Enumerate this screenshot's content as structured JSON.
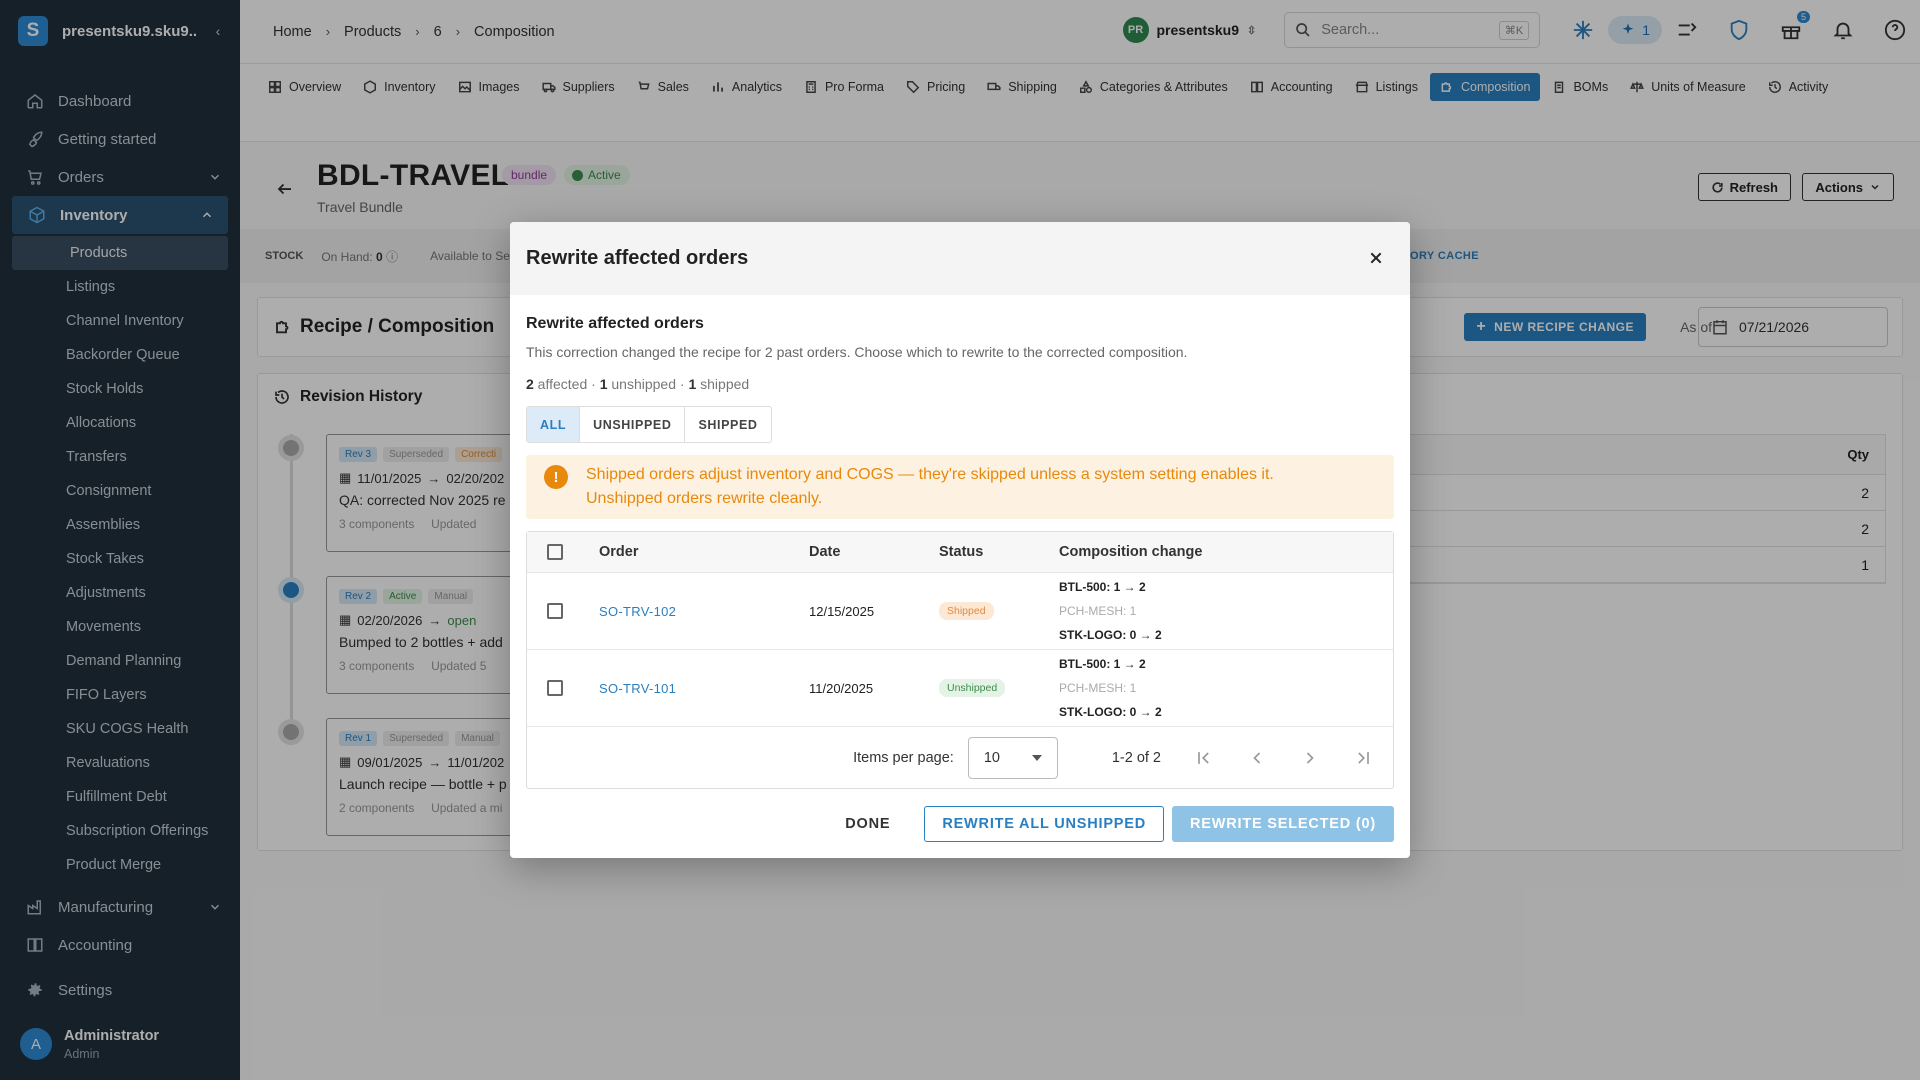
{
  "sidebar": {
    "org": "presentsku9.sku9....",
    "nav": [
      {
        "label": "Dashboard",
        "icon": "home-icon"
      },
      {
        "label": "Getting started",
        "icon": "rocket-icon"
      },
      {
        "label": "Orders",
        "icon": "cart-icon"
      },
      {
        "label": "Inventory",
        "icon": "box-icon"
      }
    ],
    "inventory_sub": [
      "Products",
      "Listings",
      "Channel Inventory",
      "Backorder Queue",
      "Stock Holds",
      "Allocations",
      "Transfers",
      "Consignment",
      "Assemblies",
      "Stock Takes",
      "Adjustments",
      "Movements",
      "Demand Planning",
      "FIFO Layers",
      "SKU COGS Health",
      "Revaluations",
      "Fulfillment Debt",
      "Subscription Offerings",
      "Product Merge"
    ],
    "manufacturing": "Manufacturing",
    "accounting": "Accounting",
    "settings": "Settings",
    "user": {
      "initial": "A",
      "name": "Administrator",
      "role": "Admin"
    }
  },
  "topbar": {
    "crumbs": [
      "Home",
      "Products",
      "6",
      "Composition"
    ],
    "user_initials": "PR",
    "user_name": "presentsku9",
    "search_placeholder": "Search...",
    "search_shortcut": "⌘K",
    "ai_count": "1",
    "gift_badge": "5"
  },
  "tabs": [
    "Overview",
    "Inventory",
    "Images",
    "Suppliers",
    "Sales",
    "Analytics",
    "Pro Forma",
    "Pricing",
    "Shipping",
    "Categories & Attributes",
    "Accounting",
    "Listings",
    "Composition",
    "BOMs",
    "Units of Measure",
    "Activity"
  ],
  "active_tab": "Composition",
  "product": {
    "sku": "BDL-TRAVEL",
    "type_badge": "bundle",
    "status": "Active",
    "name": "Travel Bundle",
    "refresh": "Refresh",
    "actions": "Actions"
  },
  "stock": {
    "label": "STOCK",
    "on_hand_label": "On Hand:",
    "on_hand": "0",
    "available": "Available to Se",
    "cache_link": "ORY CACHE"
  },
  "recipe": {
    "title": "Recipe / Composition",
    "new_change": "NEW RECIPE CHANGE",
    "as_of": "As of",
    "date": "07/21/2026",
    "qty_header": "Qty",
    "qtys": [
      "2",
      "2",
      "1"
    ]
  },
  "history": {
    "title": "Revision History",
    "revisions": [
      {
        "rev": "Rev 3",
        "state": "Superseded",
        "kind": "Correcti",
        "from": "11/01/2025",
        "to": "02/20/202",
        "desc": "QA: corrected Nov 2025 re",
        "components": "3 components",
        "updated": "Updated"
      },
      {
        "rev": "Rev 2",
        "state": "Active",
        "kind": "Manual",
        "from": "02/20/2026",
        "to": "open",
        "desc": "Bumped to 2 bottles + add",
        "components": "3 components",
        "updated": "Updated 5"
      },
      {
        "rev": "Rev 1",
        "state": "Superseded",
        "kind": "Manual",
        "from": "09/01/2025",
        "to": "11/01/202",
        "desc": "Launch recipe — bottle + p",
        "components": "2 components",
        "updated": "Updated a mi"
      }
    ]
  },
  "modal": {
    "title": "Rewrite affected orders",
    "subtitle": "Rewrite affected orders",
    "description": "This correction changed the recipe for 2 past orders. Choose which to rewrite to the corrected composition.",
    "counts": {
      "affected": "2",
      "affected_label": " affected · ",
      "unshipped": "1",
      "unshipped_label": " unshipped · ",
      "shipped": "1",
      "shipped_label": " shipped"
    },
    "filters": [
      "ALL",
      "UNSHIPPED",
      "SHIPPED"
    ],
    "warning": "Shipped orders adjust inventory and COGS — they're skipped unless a system setting enables it. Unshipped orders rewrite cleanly.",
    "columns": [
      "Order",
      "Date",
      "Status",
      "Composition change"
    ],
    "rows": [
      {
        "order": "SO-TRV-102",
        "date": "12/15/2025",
        "status": "Shipped",
        "changes": [
          "BTL-500: 1 → 2",
          "PCH-MESH: 1",
          "STK-LOGO: 0 → 2"
        ]
      },
      {
        "order": "SO-TRV-101",
        "date": "11/20/2025",
        "status": "Unshipped",
        "changes": [
          "BTL-500: 1 → 2",
          "PCH-MESH: 1",
          "STK-LOGO: 0 → 2"
        ]
      }
    ],
    "pager": {
      "label": "Items per page:",
      "per_page": "10",
      "range": "1-2 of 2"
    },
    "buttons": {
      "done": "DONE",
      "rewrite_all": "REWRITE ALL UNSHIPPED",
      "rewrite_selected": "REWRITE SELECTED (0)"
    }
  }
}
